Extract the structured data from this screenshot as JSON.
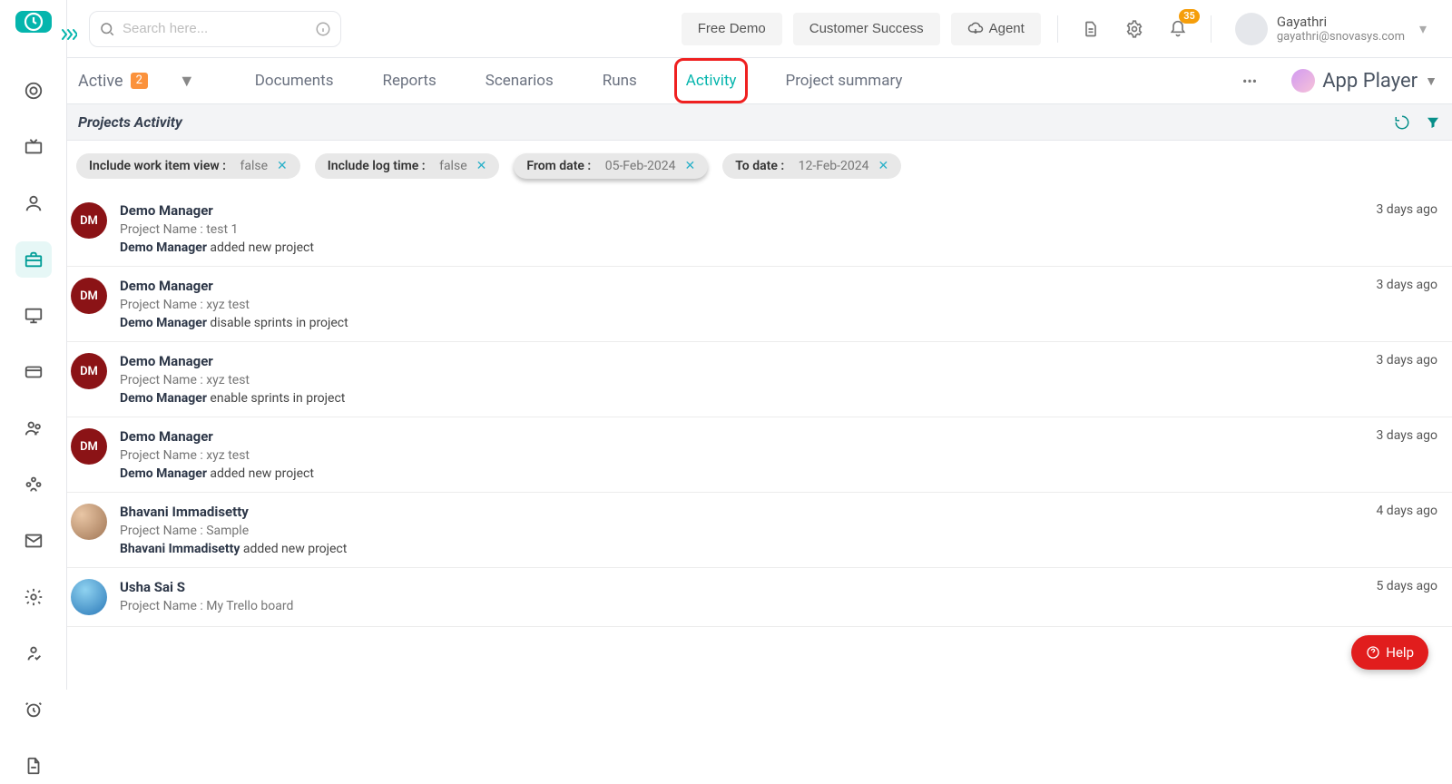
{
  "search": {
    "placeholder": "Search here..."
  },
  "topbar": {
    "free_demo": "Free Demo",
    "customer_success": "Customer Success",
    "agent": "Agent",
    "notif_count": "35",
    "user_name": "Gayathri",
    "user_email": "gayathri@snovasys.com"
  },
  "status_filter": {
    "label": "Active",
    "count": "2"
  },
  "tabs": {
    "documents": "Documents",
    "reports": "Reports",
    "scenarios": "Scenarios",
    "runs": "Runs",
    "activity": "Activity",
    "project_summary": "Project summary"
  },
  "app_player": {
    "label": "App Player"
  },
  "section_title": "Projects Activity",
  "chips": [
    {
      "label": "Include work item view :",
      "value": "false"
    },
    {
      "label": "Include log time :",
      "value": "false"
    },
    {
      "label": "From date :",
      "value": "05-Feb-2024"
    },
    {
      "label": "To date :",
      "value": "12-Feb-2024"
    }
  ],
  "project_label": "Project Name : ",
  "rows": [
    {
      "initials": "DM",
      "avatar_class": "dm",
      "name": "Demo Manager",
      "project": "test 1",
      "actor": "Demo Manager",
      "action": " added new project",
      "time": "3 days ago"
    },
    {
      "initials": "DM",
      "avatar_class": "dm",
      "name": "Demo Manager",
      "project": "xyz test",
      "actor": "Demo Manager",
      "action": " disable sprints in project",
      "time": "3 days ago"
    },
    {
      "initials": "DM",
      "avatar_class": "dm",
      "name": "Demo Manager",
      "project": "xyz test",
      "actor": "Demo Manager",
      "action": " enable sprints in project",
      "time": "3 days ago"
    },
    {
      "initials": "DM",
      "avatar_class": "dm",
      "name": "Demo Manager",
      "project": "xyz test",
      "actor": "Demo Manager",
      "action": " added new project",
      "time": "3 days ago"
    },
    {
      "initials": "",
      "avatar_class": "photo1",
      "name": "Bhavani Immadisetty",
      "project": "Sample",
      "actor": "Bhavani Immadisetty",
      "action": " added new project",
      "time": "4 days ago"
    },
    {
      "initials": "",
      "avatar_class": "photo2",
      "name": "Usha Sai S",
      "project": "My Trello board",
      "actor": "",
      "action": "",
      "time": "5 days ago"
    }
  ],
  "help_label": "Help"
}
